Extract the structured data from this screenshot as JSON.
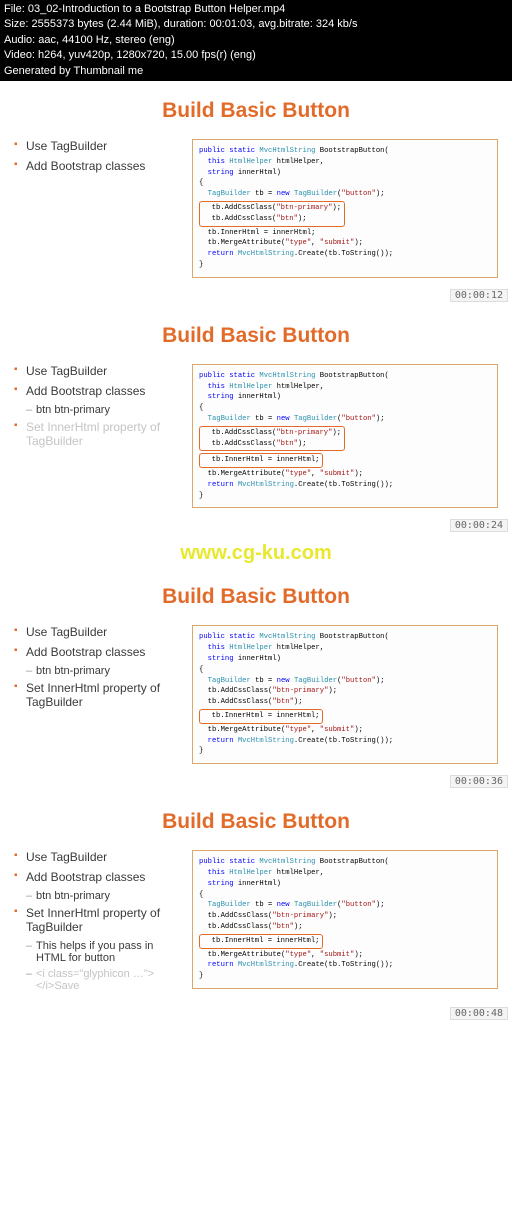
{
  "meta": {
    "file": "File: 03_02-Introduction to a Bootstrap Button Helper.mp4",
    "size": "Size: 2555373 bytes (2.44 MiB), duration: 00:01:03, avg.bitrate: 324 kb/s",
    "audio": "Audio: aac, 44100 Hz, stereo (eng)",
    "video": "Video: h264, yuv420p, 1280x720, 15.00 fps(r) (eng)",
    "gen": "Generated by Thumbnail me"
  },
  "watermark": "www.cg-ku.com",
  "slides": [
    {
      "title": "Build Basic Button",
      "timestamp": "00:00:12",
      "bullets": [
        {
          "lvl": 1,
          "text": "Use TagBuilder",
          "faded": false
        },
        {
          "lvl": 1,
          "text": "Add Bootstrap classes",
          "faded": false
        }
      ],
      "highlight_range": [
        4,
        5
      ],
      "grouped_hl": true
    },
    {
      "title": "Build Basic Button",
      "timestamp": "00:00:24",
      "bullets": [
        {
          "lvl": 1,
          "text": "Use TagBuilder",
          "faded": false
        },
        {
          "lvl": 1,
          "text": "Add Bootstrap classes",
          "faded": false
        },
        {
          "lvl": 2,
          "text": "btn btn-primary",
          "faded": false
        },
        {
          "lvl": 1,
          "text": "Set InnerHtml property of TagBuilder",
          "faded": true
        }
      ],
      "highlight_range": [
        4,
        6
      ],
      "grouped_hl": false
    },
    {
      "title": "Build Basic Button",
      "timestamp": "00:00:36",
      "bullets": [
        {
          "lvl": 1,
          "text": "Use TagBuilder",
          "faded": false
        },
        {
          "lvl": 1,
          "text": "Add Bootstrap classes",
          "faded": false
        },
        {
          "lvl": 2,
          "text": "btn btn-primary",
          "faded": false
        },
        {
          "lvl": 1,
          "text": "Set InnerHtml property of TagBuilder",
          "faded": false
        }
      ],
      "highlight_range": [
        6,
        6
      ],
      "grouped_hl": true
    },
    {
      "title": "Build Basic Button",
      "timestamp": "00:00:48",
      "bullets": [
        {
          "lvl": 1,
          "text": "Use TagBuilder",
          "faded": false
        },
        {
          "lvl": 1,
          "text": "Add Bootstrap classes",
          "faded": false
        },
        {
          "lvl": 2,
          "text": "btn btn-primary",
          "faded": false
        },
        {
          "lvl": 1,
          "text": "Set InnerHtml property of TagBuilder",
          "faded": false
        },
        {
          "lvl": 2,
          "text": "This helps if you pass in HTML for button",
          "faded": false
        },
        {
          "lvl": 2,
          "text": "<i class=\"glyphicon …\"></i>Save",
          "faded": true
        }
      ],
      "highlight_range": [
        6,
        6
      ],
      "grouped_hl": true
    }
  ],
  "code": {
    "l0_a": "public static ",
    "l0_b": "MvcHtmlString",
    "l0_c": " BootstrapButton(",
    "l1_a": "  this ",
    "l1_b": "HtmlHelper",
    "l1_c": " htmlHelper,",
    "l2_a": "  string",
    "l2_b": " innerHtml)",
    "l3": "{",
    "l4_a": "  ",
    "l4_b": "TagBuilder",
    "l4_c": " tb = ",
    "l4_d": "new ",
    "l4_e": "TagBuilder",
    "l4_f": "(",
    "l4_g": "\"button\"",
    "l4_h": ");",
    "l5": "",
    "l6_a": "  tb.AddCssClass(",
    "l6_b": "\"btn-primary\"",
    "l6_c": ");",
    "l7_a": "  tb.AddCssClass(",
    "l7_b": "\"btn\"",
    "l7_c": ");",
    "l8": "",
    "l9": "  tb.InnerHtml = innerHtml;",
    "l10": "",
    "l11_a": "  tb.MergeAttribute(",
    "l11_b": "\"type\"",
    "l11_c": ", ",
    "l11_d": "\"submit\"",
    "l11_e": ");",
    "l12": "",
    "l13_a": "  return ",
    "l13_b": "MvcHtmlString",
    "l13_c": ".Create(tb.ToString());",
    "l14": "}"
  }
}
